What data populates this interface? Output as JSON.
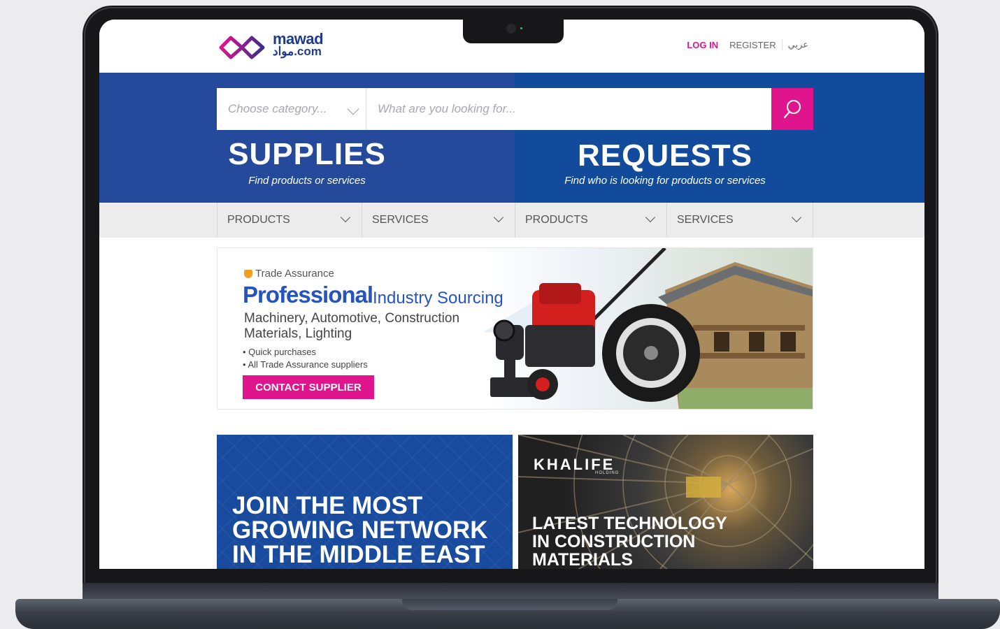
{
  "header": {
    "logo_en": "mawad",
    "logo_ar": "مواد.com",
    "login": "LOG IN",
    "register": "REGISTER",
    "language": "عربي"
  },
  "search": {
    "category_placeholder": "Choose category...",
    "placeholder": "What are you looking for..."
  },
  "hero": {
    "supplies_title": "SUPPLIES",
    "supplies_sub": "Find products or services",
    "requests_title": "REQUESTS",
    "requests_sub": "Find who is looking for products or services"
  },
  "nav": {
    "items": [
      {
        "label": "PRODUCTS"
      },
      {
        "label": "SERVICES"
      },
      {
        "label": "PRODUCTS"
      },
      {
        "label": "SERVICES"
      }
    ]
  },
  "banner": {
    "trade_assurance": "Trade Assurance",
    "professional": "Professional",
    "industry_sourcing": "Industry Sourcing",
    "machinery": "Machinery, Automotive, Construction Materials, Lighting",
    "bullets": [
      "Quick purchases",
      "All Trade Assurance suppliers"
    ],
    "cta": "CONTACT SUPPLIER"
  },
  "tiles": {
    "left_text": "JOIN THE MOST GROWING NETWORK IN THE MIDDLE EAST",
    "right_brand": "KHALIFE",
    "right_brand_sub": "HOLDING",
    "right_text": "LATEST TECHNOLOGY IN CONSTRUCTION MATERIALS"
  },
  "colors": {
    "brand_blue": "#264a9b",
    "requests_blue": "#124b9c",
    "accent_pink": "#e0148c",
    "nav_gray": "#ececec"
  },
  "icons": {
    "search": "search-icon",
    "chevron": "chevron-down-icon",
    "logo": "mawad-logo-icon",
    "shield": "trade-assurance-icon"
  }
}
